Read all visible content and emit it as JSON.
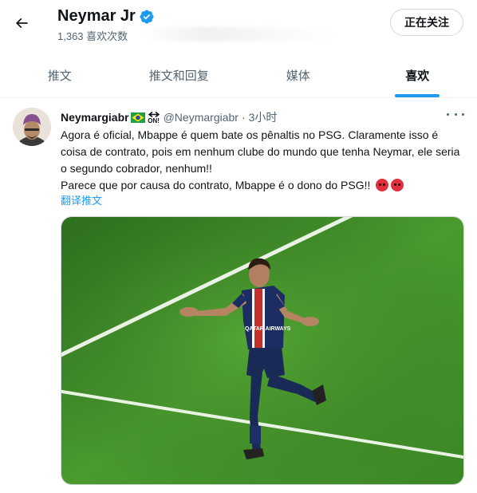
{
  "header": {
    "title": "Neymar Jr",
    "subtitle": "1,363 喜欢次数",
    "follow_label": "正在关注",
    "back_icon": "arrow-left-icon",
    "verified_icon": "verified-badge-icon"
  },
  "tabs": [
    {
      "label": "推文",
      "active": false
    },
    {
      "label": "推文和回复",
      "active": false
    },
    {
      "label": "媒体",
      "active": false
    },
    {
      "label": "喜欢",
      "active": true
    }
  ],
  "tweet": {
    "author_name": "Neymargiabr",
    "handle": "@Neymargiabr",
    "dot": "·",
    "time": "3小时",
    "on_badge": "ON!",
    "lines": [
      "Agora é oficial, Mbappe é quem bate os pênaltis no PSG. Claramente isso é coisa de contrato, pois em nenhum clube do mundo que tenha Neymar, ele seria o segundo cobrador, nenhum!!",
      "Parece que por causa do contrato, Mbappe é o dono do PSG!!"
    ],
    "translate_label": "翻译推文",
    "more_icon": "more-dots-icon",
    "media": {
      "jersey_sponsor": "QATAR AIRWAYS"
    }
  },
  "colors": {
    "accent": "#1d9bf0",
    "text_primary": "#0f1419",
    "text_secondary": "#536471",
    "pitch": "#3f8a2a"
  }
}
